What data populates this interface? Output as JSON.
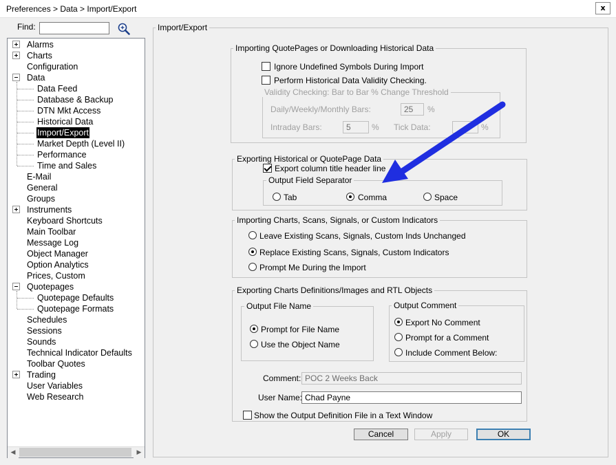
{
  "window": {
    "title": "Preferences > Data > Import/Export",
    "close_label": "x"
  },
  "find": {
    "label": "Find:",
    "value": ""
  },
  "tree": {
    "items": [
      {
        "label": "Alarms",
        "expander": "plus"
      },
      {
        "label": "Charts",
        "expander": "plus"
      },
      {
        "label": "Configuration"
      },
      {
        "label": "Data",
        "expander": "minus"
      },
      {
        "label": "Data Feed"
      },
      {
        "label": "Database & Backup"
      },
      {
        "label": "DTN Mkt Access"
      },
      {
        "label": "Historical Data"
      },
      {
        "label": "Import/Export",
        "selected": true
      },
      {
        "label": "Market Depth (Level II)"
      },
      {
        "label": "Performance"
      },
      {
        "label": "Time and Sales"
      },
      {
        "label": "E-Mail"
      },
      {
        "label": "General"
      },
      {
        "label": "Groups"
      },
      {
        "label": "Instruments",
        "expander": "plus"
      },
      {
        "label": "Keyboard Shortcuts"
      },
      {
        "label": "Main Toolbar"
      },
      {
        "label": "Message Log"
      },
      {
        "label": "Object Manager"
      },
      {
        "label": "Option Analytics"
      },
      {
        "label": "Prices, Custom"
      },
      {
        "label": "Quotepages",
        "expander": "minus"
      },
      {
        "label": "Quotepage Defaults"
      },
      {
        "label": "Quotepage Formats"
      },
      {
        "label": "Schedules"
      },
      {
        "label": "Sessions"
      },
      {
        "label": "Sounds"
      },
      {
        "label": "Technical Indicator Defaults"
      },
      {
        "label": "Toolbar Quotes"
      },
      {
        "label": "Trading",
        "expander": "plus"
      },
      {
        "label": "User Variables"
      },
      {
        "label": "Web Research"
      }
    ]
  },
  "panel": {
    "title": "Import/Export",
    "import_quotepages": {
      "title": "Importing QuotePages or Downloading Historical Data",
      "ignore_undefined": {
        "label": "Ignore Undefined Symbols During Import",
        "checked": false
      },
      "validity_check": {
        "label": "Perform Historical Data Validity Checking.",
        "checked": false
      },
      "threshold": {
        "title": "Validity Checking: Bar to Bar % Change Threshold",
        "dwm_label": "Daily/Weekly/Monthly Bars:",
        "dwm_value": "25",
        "intraday_label": "Intraday Bars:",
        "intraday_value": "5",
        "tick_label": "Tick Data:",
        "tick_value": "",
        "percent": "%"
      }
    },
    "export_historical": {
      "title": "Exporting Historical or QuotePage Data",
      "header_line": {
        "label": "Export column title header line",
        "checked": true
      },
      "separator": {
        "title": "Output Field Separator",
        "options": [
          {
            "label": "Tab",
            "checked": false
          },
          {
            "label": "Comma",
            "checked": true
          },
          {
            "label": "Space",
            "checked": false
          }
        ]
      }
    },
    "import_charts": {
      "title": "Importing Charts, Scans, Signals, or Custom Indicators",
      "options": [
        {
          "label": "Leave Existing Scans, Signals, Custom Inds Unchanged",
          "checked": false
        },
        {
          "label": "Replace Existing Scans, Signals, Custom Indicators",
          "checked": true
        },
        {
          "label": "Prompt Me During the Import",
          "checked": false
        }
      ]
    },
    "export_charts": {
      "title": "Exporting Charts Definitions/Images and RTL Objects",
      "file_name": {
        "title": "Output File Name",
        "options": [
          {
            "label": "Prompt for File Name",
            "checked": true
          },
          {
            "label": "Use the Object Name",
            "checked": false
          }
        ]
      },
      "comment": {
        "title": "Output Comment",
        "options": [
          {
            "label": "Export No Comment",
            "checked": true
          },
          {
            "label": "Prompt for a Comment",
            "checked": false
          },
          {
            "label": "Include Comment Below:",
            "checked": false
          }
        ]
      },
      "comment_label": "Comment:",
      "comment_value": "POC 2 Weeks Back",
      "username_label": "User Name:",
      "username_value": "Chad Payne",
      "show_definition": {
        "label": "Show the Output Definition File in a Text Window",
        "checked": false
      }
    }
  },
  "buttons": {
    "cancel": "Cancel",
    "apply": "Apply",
    "ok": "OK"
  },
  "colors": {
    "arrow": "#1f2ee0",
    "selection": "#000000",
    "default_button_border": "#3c7fb1"
  },
  "icons": {
    "find": "search-icon",
    "annotation": "arrow-annotation"
  }
}
